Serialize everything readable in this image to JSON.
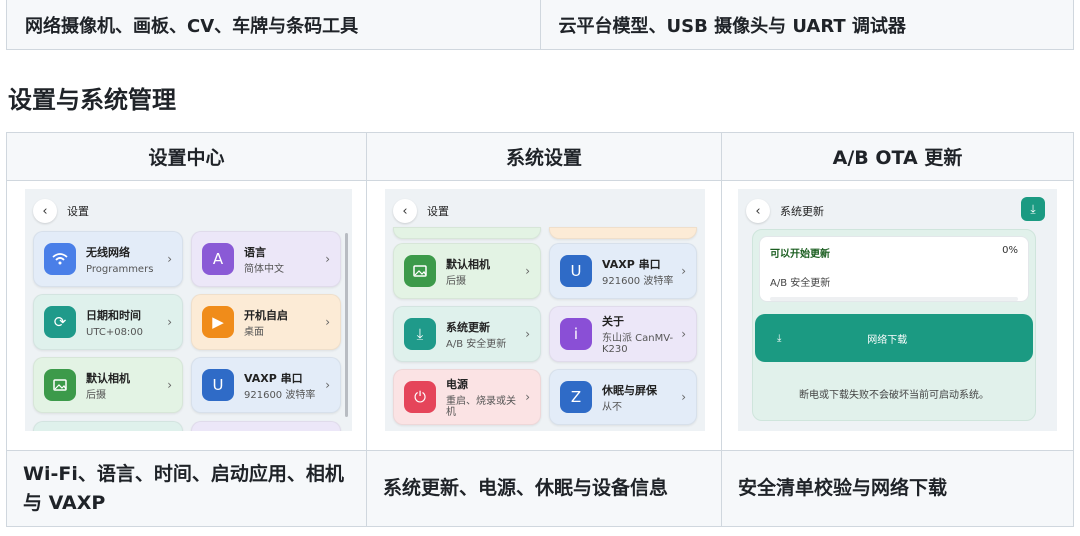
{
  "top_row": {
    "left": "网络摄像机、画板、CV、车牌与条码工具",
    "right": "云平台模型、USB 摄像头与 UART 调试器"
  },
  "section_title": "设置与系统管理",
  "table": {
    "headers": [
      "设置中心",
      "系统设置",
      "A/B OTA 更新"
    ],
    "descriptions": [
      "Wi-Fi、语言、时间、启动应用、相机与 VAXP",
      "系统更新、电源、休眠与设备信息",
      "安全清单校验与网络下载"
    ]
  },
  "shot1": {
    "header": "设置",
    "cards": [
      {
        "title": "无线网络",
        "sub": "Programmers",
        "icon": "wifi-icon",
        "color": "#4a7fe8"
      },
      {
        "title": "语言",
        "sub": "简体中文",
        "icon": "A",
        "color": "#8a5ad6"
      },
      {
        "title": "日期和时间",
        "sub": "UTC+08:00",
        "icon": "refresh-icon",
        "color": "#1f9a8a"
      },
      {
        "title": "开机自启",
        "sub": "桌面",
        "icon": "play-icon",
        "color": "#f08c1a"
      },
      {
        "title": "默认相机",
        "sub": "后摄",
        "icon": "image-icon",
        "color": "#3c9a4a"
      },
      {
        "title": "VAXP 串口",
        "sub": "921600 波特率",
        "icon": "U",
        "color": "#2f6bc7"
      }
    ]
  },
  "shot2": {
    "header": "设置",
    "cards": [
      {
        "title": "默认相机",
        "sub": "后摄",
        "icon": "image-icon",
        "color": "#3c9a4a"
      },
      {
        "title": "VAXP 串口",
        "sub": "921600 波特率",
        "icon": "U",
        "color": "#2f6bc7"
      },
      {
        "title": "系统更新",
        "sub": "A/B 安全更新",
        "icon": "download-icon",
        "color": "#1f9a8a"
      },
      {
        "title": "关于",
        "sub": "东山派 CanMV-K230",
        "icon": "i",
        "color": "#8a4fd6"
      },
      {
        "title": "电源",
        "sub": "重启、烧录或关机",
        "icon": "power-icon",
        "color": "#e5455a"
      },
      {
        "title": "休眠与屏保",
        "sub": "从不",
        "icon": "Z",
        "color": "#2f6bc7"
      }
    ]
  },
  "shot3": {
    "header": "系统更新",
    "status_title": "可以开始更新",
    "percent": "0%",
    "mode": "A/B 安全更新",
    "download_label": "网络下载",
    "note": "断电或下载失败不会破坏当前可启动系统。"
  }
}
